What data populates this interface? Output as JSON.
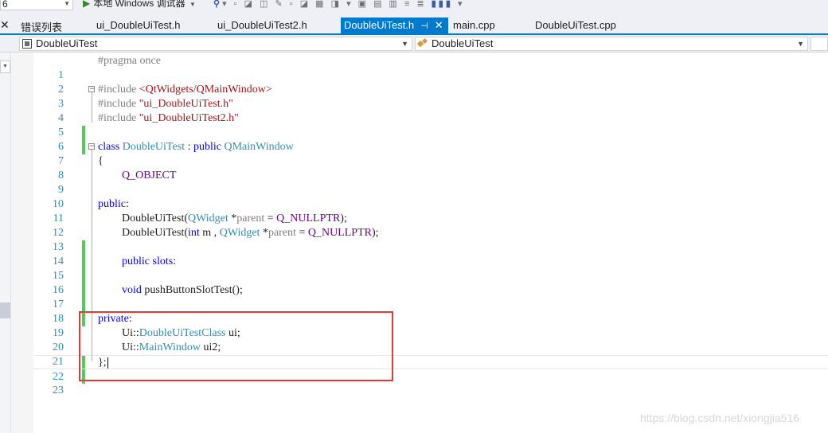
{
  "toolbar": {
    "config_value": "6",
    "run_label": "本地 Windows 调试器",
    "run_icon": "play-icon"
  },
  "tabs": {
    "close_glyph": "✕",
    "items": [
      {
        "label": "错误列表"
      },
      {
        "label": "ui_DoubleUiTest.h"
      },
      {
        "label": "ui_DoubleUiTest2.h"
      },
      {
        "label": "DoubleUiTest.h",
        "active": true
      },
      {
        "label": "main.cpp"
      },
      {
        "label": "DoubleUiTest.cpp"
      }
    ],
    "pin_glyph": "⊣",
    "tab_close_glyph": "✕"
  },
  "navbar": {
    "project": "DoubleUiTest",
    "scope": "DoubleUiTest"
  },
  "editor": {
    "line_numbers": [
      "1",
      "2",
      "3",
      "4",
      "5",
      "6",
      "7",
      "8",
      "9",
      "10",
      "11",
      "12",
      "13",
      "14",
      "15",
      "16",
      "17",
      "18",
      "19",
      "20",
      "21",
      "22",
      "23"
    ],
    "lines": {
      "l1": "#pragma once",
      "l3_directive": "#include ",
      "l3_path": "<QtWidgets/QMainWindow>",
      "l4_directive": "#include ",
      "l4_path": "\"ui_DoubleUiTest.h\"",
      "l5_directive": "#include ",
      "l5_path": "\"ui_DoubleUiTest2.h\"",
      "l7_class": "class",
      "l7_name": "DoubleUiTest",
      "l7_colon": " : ",
      "l7_public": "public",
      "l7_base": "QMainWindow",
      "l8": "{",
      "l9": "Q_OBJECT",
      "l11_kw": "public",
      "l11_colon": ":",
      "l12_a": "DoubleUiTest(",
      "l12_type": "QWidget",
      "l12_b": " *",
      "l12_param": "parent",
      "l12_c": " = ",
      "l12_macro": "Q_NULLPTR",
      "l12_d": ");",
      "l13_a": "DoubleUiTest(",
      "l13_int": "int",
      "l13_b": " m , ",
      "l13_type": "QWidget",
      "l13_c": " *",
      "l13_param": "parent",
      "l13_d": " = ",
      "l13_macro": "Q_NULLPTR",
      "l13_e": ");",
      "l15_kw": "public",
      "l15_slots": " slots",
      "l15_colon": ":",
      "l17_void": "void",
      "l17_rest": " pushButtonSlotTest();",
      "l19_kw": "private",
      "l19_colon": ":",
      "l20_ns": "Ui::",
      "l20_type": "DoubleUiTestClass",
      "l20_rest": " ui;",
      "l21_ns": "Ui::",
      "l21_type": "MainWindow",
      "l21_rest": " ui2;",
      "l22": "};"
    }
  },
  "watermark": "https://blog.csdn.net/xiongjia516",
  "colors": {
    "keyword": "#0000ff",
    "type": "#2b91af",
    "string": "#a31515",
    "macro": "#6f008a",
    "change_bar": "#57c957",
    "active_tab": "#007acc",
    "highlight_box": "#e53935"
  }
}
